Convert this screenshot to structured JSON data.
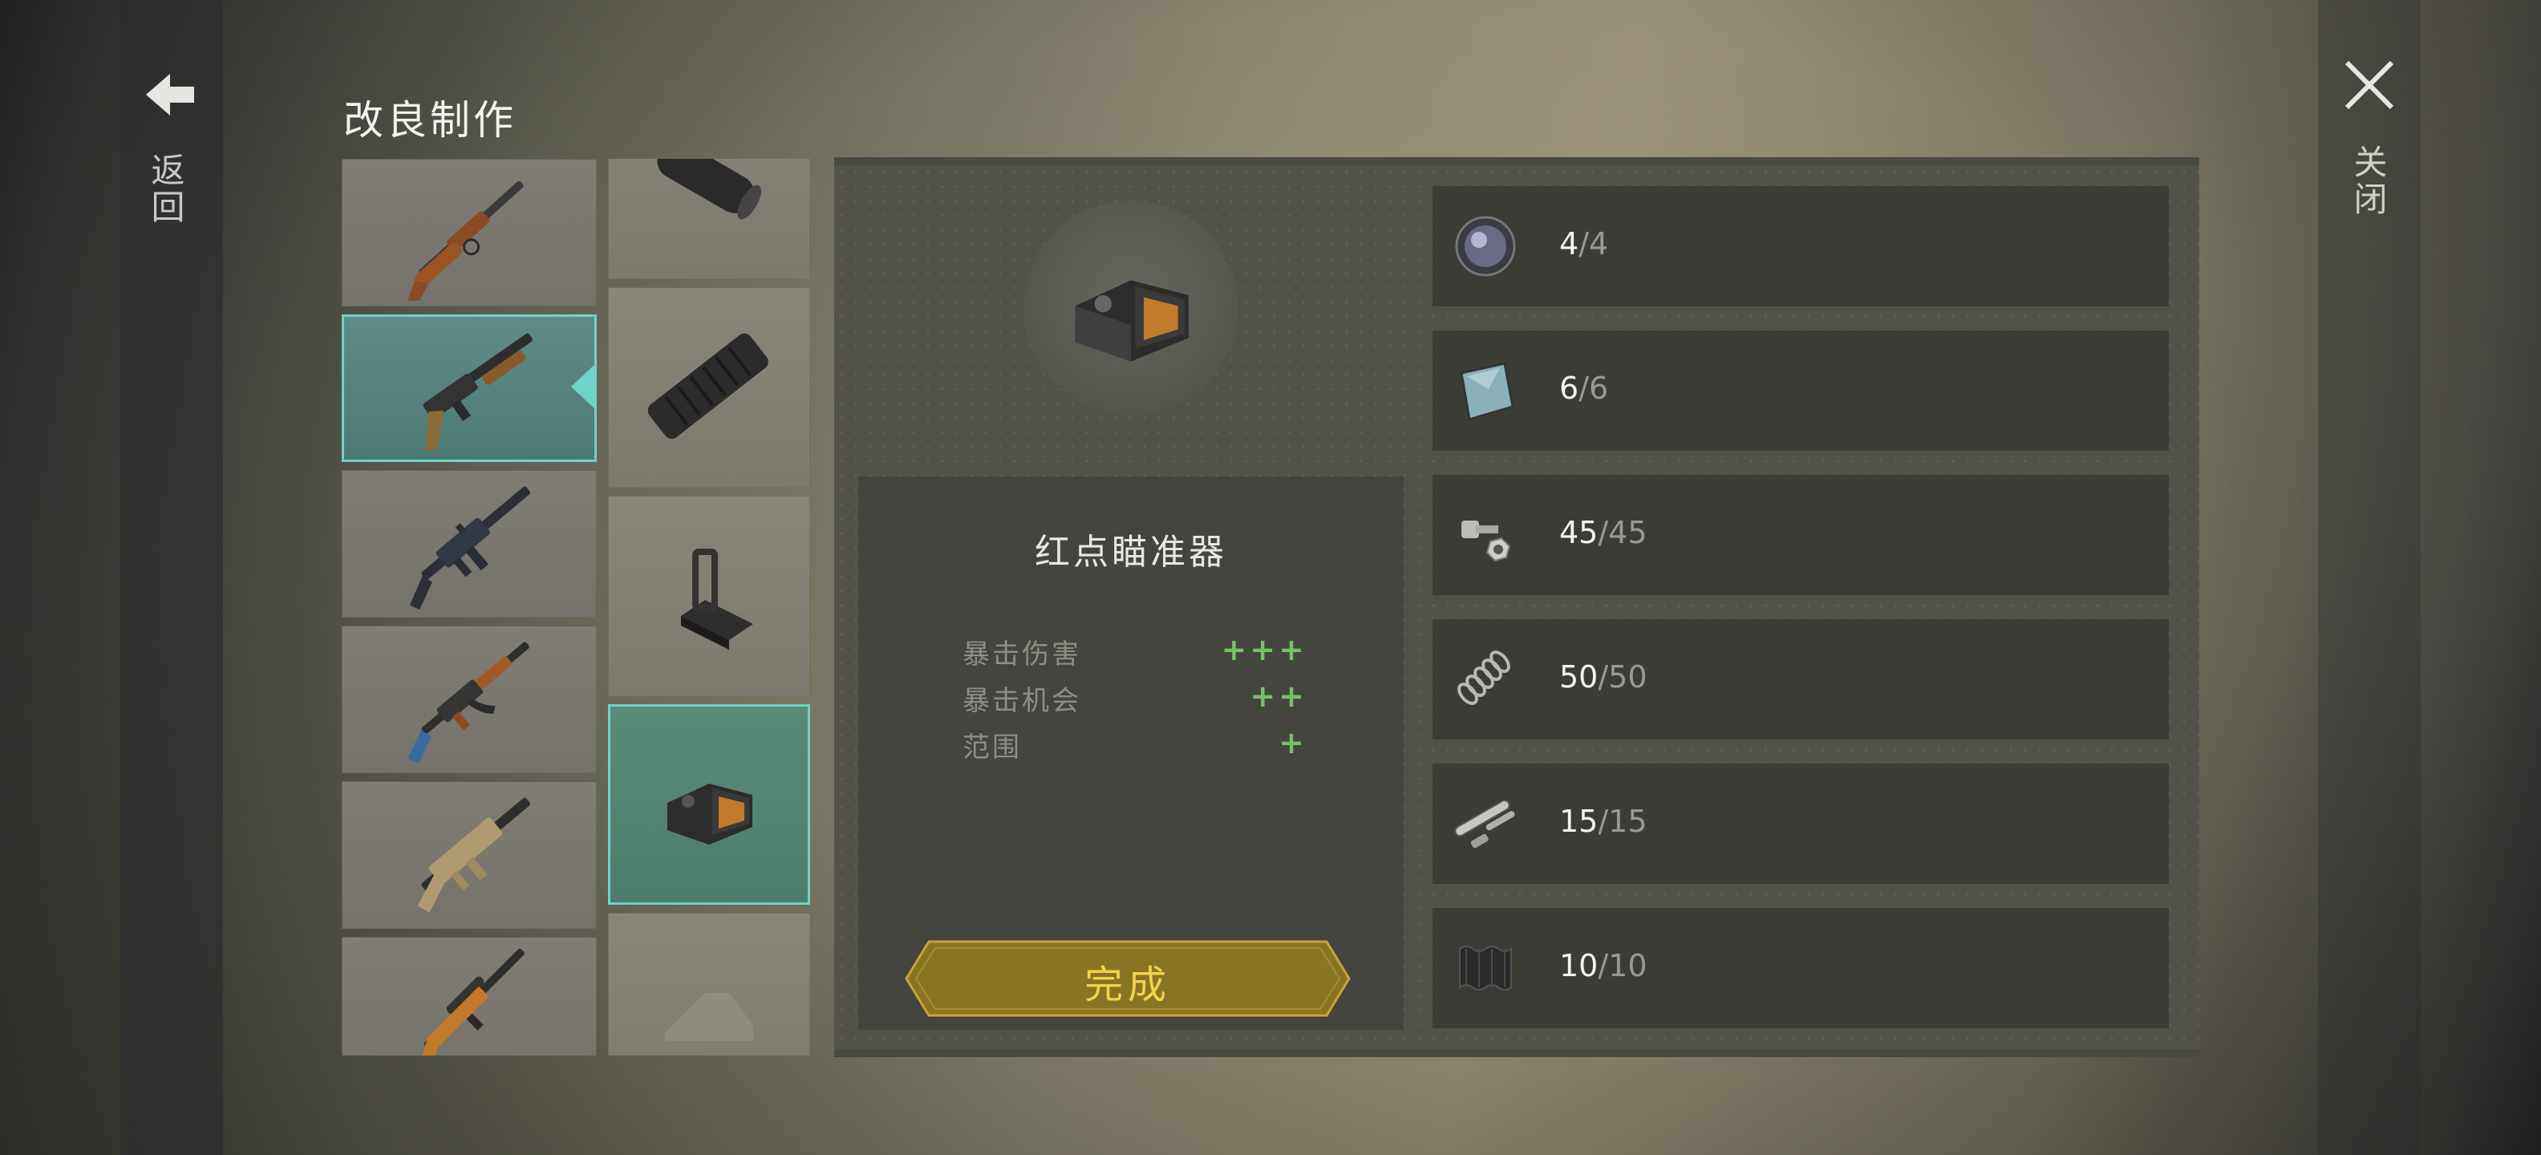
{
  "header": {
    "title": "改良制作"
  },
  "nav": {
    "back_label": "返回",
    "close_label": "关闭"
  },
  "weapons": [
    {
      "name": "lever-action-rifle"
    },
    {
      "name": "pump-shotgun",
      "selected": true
    },
    {
      "name": "m16-rifle"
    },
    {
      "name": "ak-rifle"
    },
    {
      "name": "scar-rifle"
    },
    {
      "name": "sniper-rifle"
    }
  ],
  "attachments": [
    {
      "name": "suppressor"
    },
    {
      "name": "foregrip"
    },
    {
      "name": "iron-sight"
    },
    {
      "name": "red-dot-sight",
      "selected": true
    },
    {
      "name": "stock-locked"
    }
  ],
  "item": {
    "name": "红点瞄准器",
    "stats": [
      {
        "label": "暴击伤害",
        "value": "+++"
      },
      {
        "label": "暴击机会",
        "value": "++"
      },
      {
        "label": "范围",
        "value": "+"
      }
    ],
    "complete_label": "完成"
  },
  "materials": [
    {
      "icon": "lens-icon",
      "have": "4",
      "sep": "/",
      "need": "4"
    },
    {
      "icon": "glass-plate-icon",
      "have": "6",
      "sep": "/",
      "need": "6"
    },
    {
      "icon": "bolts-nuts-icon",
      "have": "45",
      "sep": "/",
      "need": "45"
    },
    {
      "icon": "spring-icon",
      "have": "50",
      "sep": "/",
      "need": "50"
    },
    {
      "icon": "pipe-parts-icon",
      "have": "15",
      "sep": "/",
      "need": "15"
    },
    {
      "icon": "corrugated-metal-icon",
      "have": "10",
      "sep": "/",
      "need": "10"
    }
  ],
  "colors": {
    "selection": "#6ed3c6",
    "stat_plus": "#74c264",
    "button_text": "#f3d24c"
  }
}
